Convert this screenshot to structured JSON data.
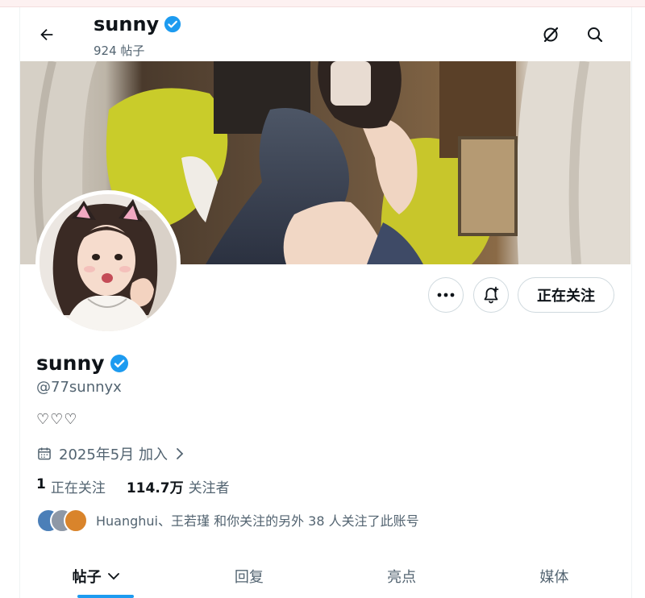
{
  "header": {
    "title": "sunny",
    "post_count": "924 帖子",
    "icons": [
      "back-arrow-icon",
      "grok-icon",
      "search-icon"
    ]
  },
  "profile": {
    "name": "sunny",
    "handle": "@77sunnyx",
    "bio": "♡♡♡",
    "joined": "2025年5月 加入",
    "following_count": "1",
    "following_label": "正在关注",
    "followers_count": "114.7万",
    "followers_label": "关注者",
    "known_followers": "Huanghui、王若瑾 和你关注的另外 38 人关注了此账号"
  },
  "actions": {
    "more_label": "•••",
    "follow_label": "正在关注"
  },
  "tabs": [
    {
      "label": "帖子",
      "active": true
    },
    {
      "label": "回复",
      "active": false
    },
    {
      "label": "亮点",
      "active": false
    },
    {
      "label": "媒体",
      "active": false
    }
  ],
  "colors": {
    "accent": "#1d9bf0",
    "text": "#0f1419",
    "muted": "#536471",
    "border": "#cfd9de"
  }
}
